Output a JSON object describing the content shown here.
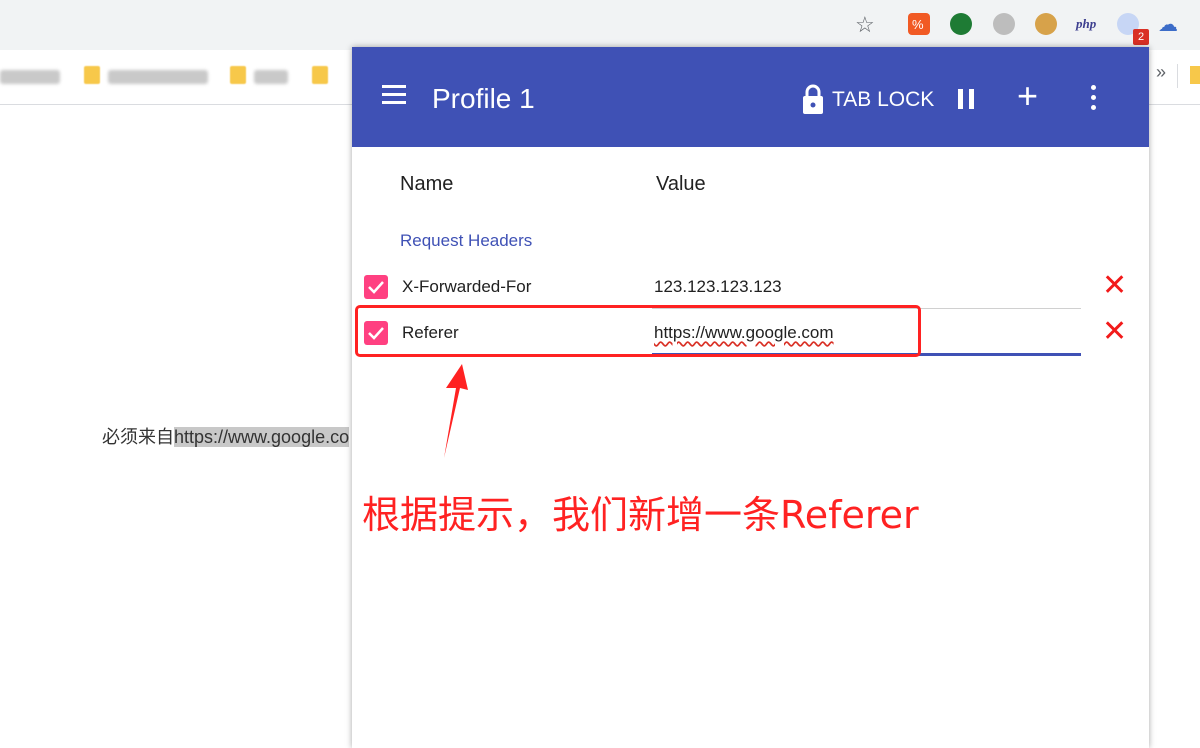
{
  "browser": {
    "extension_php_label": "php",
    "extension_badge": "2"
  },
  "page": {
    "text_prefix": "必须来自",
    "text_selected": "https://www.google.co"
  },
  "popup": {
    "title": "Profile 1",
    "tab_lock_label": "TAB LOCK",
    "columns": {
      "name": "Name",
      "value": "Value"
    },
    "section_title": "Request Headers",
    "rows": [
      {
        "name": "X-Forwarded-For",
        "value": "123.123.123.123",
        "checked": true
      },
      {
        "name": "Referer",
        "value": "https://www.google.com",
        "checked": true
      }
    ],
    "colors": {
      "header": "#3f51b5",
      "checkbox": "#ff4081",
      "delete": "#f21a1a"
    }
  },
  "annotation": {
    "text": "根据提示，我们新增一条Referer",
    "color": "#ff2222"
  }
}
